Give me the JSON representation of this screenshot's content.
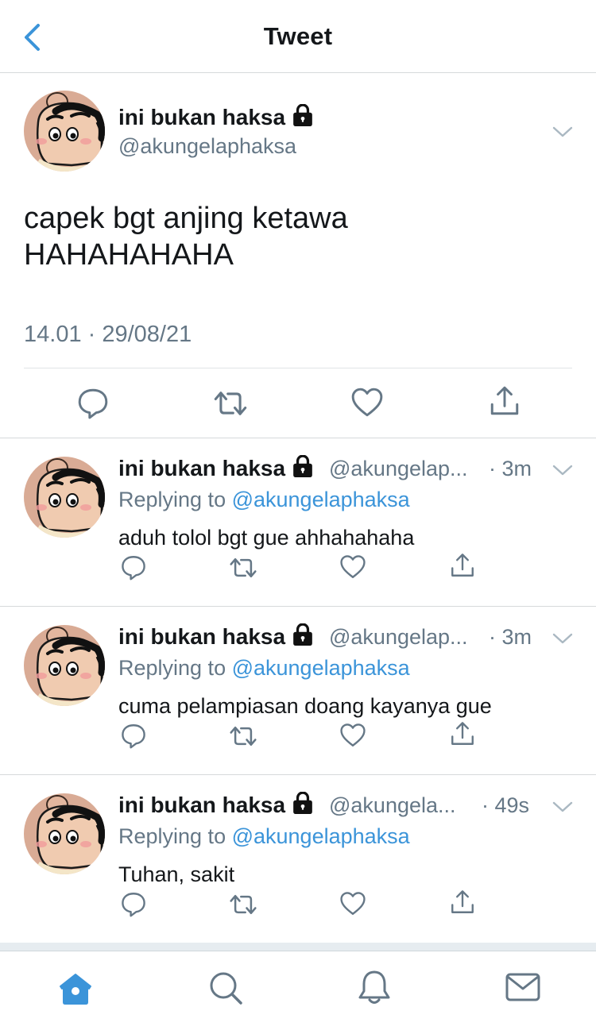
{
  "header": {
    "title": "Tweet"
  },
  "main_tweet": {
    "name": "ini bukan haksa",
    "handle": "@akungelaphaksa",
    "text_line1": "capek bgt anjing ketawa",
    "text_line2": "HAHAHAHAHA",
    "timestamp": "14.01 · 29/08/21"
  },
  "replies": [
    {
      "name": "ini bukan haksa",
      "handle": "@akungelap...",
      "time": "· 3m",
      "replying_prefix": "Replying to ",
      "replying_to": "@akungelaphaksa",
      "text": "aduh tolol bgt gue ahhahahaha"
    },
    {
      "name": "ini bukan haksa",
      "handle": "@akungelap...",
      "time": "· 3m",
      "replying_prefix": "Replying to ",
      "replying_to": "@akungelaphaksa",
      "text": "cuma pelampiasan doang kayanya gue"
    },
    {
      "name": "ini bukan haksa",
      "handle": "@akungela...",
      "time": "· 49s",
      "replying_prefix": "Replying to ",
      "replying_to": "@akungelaphaksa",
      "text": "Tuhan, sakit"
    }
  ],
  "tabs": [
    {
      "name": "home",
      "icon": "home-icon",
      "active": true
    },
    {
      "name": "search",
      "icon": "search-icon",
      "active": false
    },
    {
      "name": "notifications",
      "icon": "bell-icon",
      "active": false
    },
    {
      "name": "messages",
      "icon": "mail-icon",
      "active": false
    }
  ],
  "colors": {
    "accent": "#3b94d9",
    "secondary_text": "#657786",
    "icon_gray": "#657786"
  }
}
